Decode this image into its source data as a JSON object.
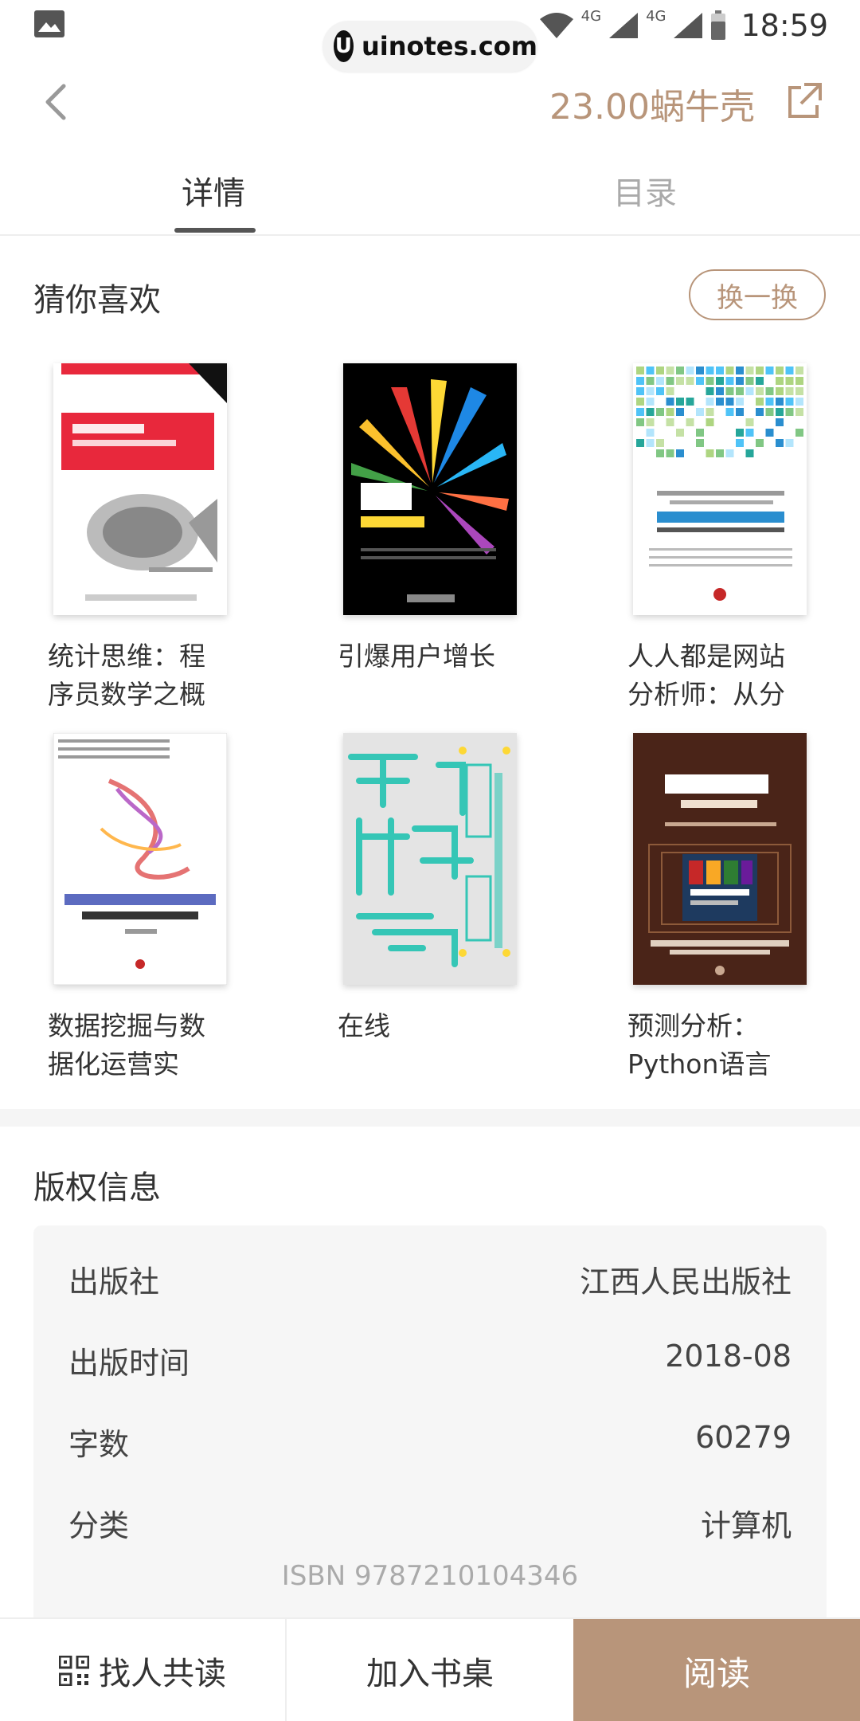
{
  "status_bar": {
    "time": "18:59",
    "network_1": "4G",
    "network_2": "4G"
  },
  "watermark": {
    "text": "uinotes.com",
    "logo_letter": "U"
  },
  "header": {
    "price": "23.00蜗牛壳",
    "back_icon": "chevron-left-icon",
    "share_icon": "share-icon"
  },
  "tabs": [
    {
      "label": "详情",
      "active": true
    },
    {
      "label": "目录",
      "active": false
    }
  ],
  "recommend": {
    "title": "猜你喜欢",
    "swap_label": "换一换",
    "books": [
      {
        "title": "统计思维：程序员数学之概",
        "cover_color": "#e8283c"
      },
      {
        "title": "引爆用户增长",
        "cover_color": "#000000"
      },
      {
        "title": "人人都是网站分析师：从分",
        "cover_color": "#2a8ecf"
      },
      {
        "title": "数据挖掘与数据化运营实",
        "cover_color": "#ffffff"
      },
      {
        "title": "在线",
        "cover_color": "#e4e4e4"
      },
      {
        "title": "预测分析：Python语言实",
        "cover_color": "#4a2418"
      }
    ]
  },
  "copyright": {
    "title": "版权信息",
    "rows": [
      {
        "label": "出版社",
        "value": "江西人民出版社"
      },
      {
        "label": "出版时间",
        "value": "2018-08"
      },
      {
        "label": "字数",
        "value": "60279"
      },
      {
        "label": "分类",
        "value": "计算机"
      }
    ],
    "isbn": "ISBN 9787210104346"
  },
  "bottom_bar": {
    "find_label": "找人共读",
    "desk_label": "加入书桌",
    "read_label": "阅读"
  },
  "colors": {
    "accent": "#b8957a"
  }
}
